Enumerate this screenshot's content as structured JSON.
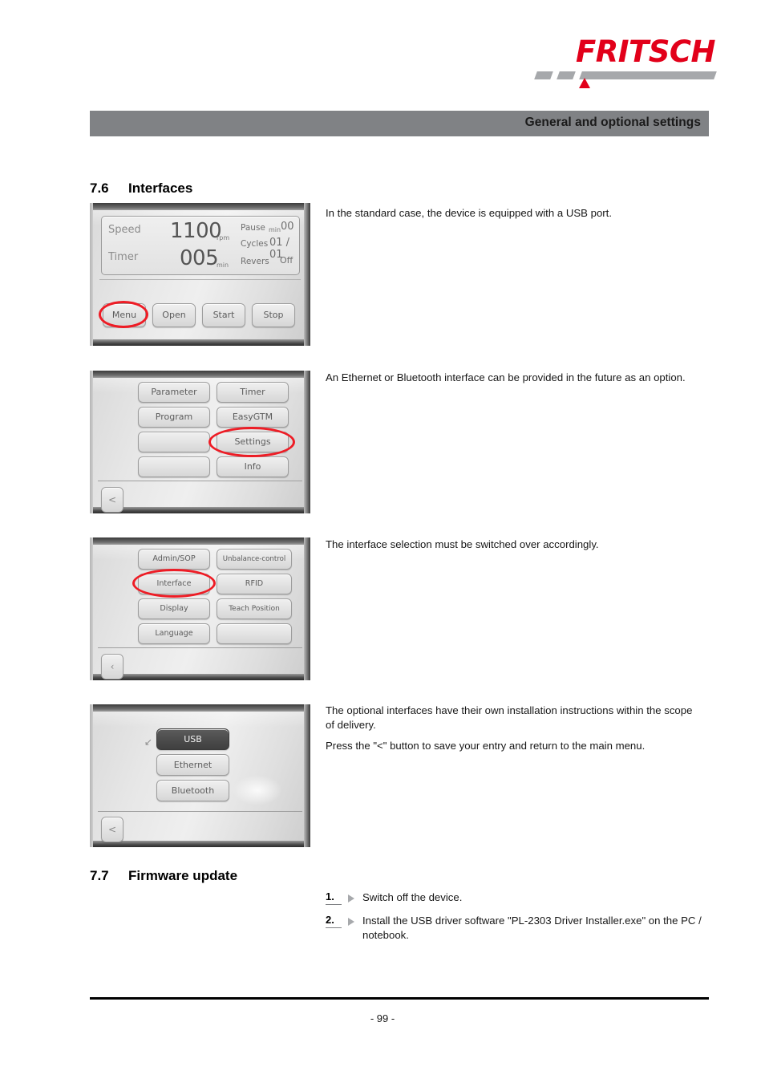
{
  "brand": {
    "logo_text": "FRITSCH",
    "logo_color": "#e2001a",
    "logo_bar_color": "#a6a8ab"
  },
  "header": {
    "running_title": "General and optional settings",
    "bar_color": "#808285"
  },
  "sections": [
    {
      "number": "7.6",
      "title": "Interfaces"
    },
    {
      "number": "7.7",
      "title": "Firmware update"
    }
  ],
  "paragraphs": {
    "p1": "In the standard case, the device is equipped with a USB port.",
    "p2": "An Ethernet or Bluetooth interface can be provided in the future as an option.",
    "p3": "The interface selection must be switched over accordingly.",
    "p4": "The optional interfaces have their own installation instructions within the scope of delivery.",
    "p5": "Press the \"<\" button to save your entry and return to the main menu."
  },
  "steps": [
    {
      "number": "1.",
      "text": "Switch off the device."
    },
    {
      "number": "2.",
      "text": "Install the USB driver software \"PL-2303 Driver Installer.exe\" on the PC / notebook."
    }
  ],
  "footer": {
    "page_number": "- 99 -"
  },
  "annotation": {
    "highlight_color": "#ee1c25"
  },
  "figures": [
    {
      "id": "figure-status-screen",
      "caption_ref": "7.6",
      "readout": {
        "speed_label": "Speed",
        "speed_value": "1100",
        "speed_unit": "rpm",
        "timer_label": "Timer",
        "timer_value": "005",
        "timer_unit": "min",
        "pause_label": "Pause",
        "pause_unit": "min",
        "pause_value": "00",
        "cycles_label": "Cycles",
        "cycles_value": "01 / 01",
        "revers_label": "Revers",
        "revers_value": "Off"
      },
      "buttons": [
        "Menu",
        "Open",
        "Start",
        "Stop"
      ],
      "highlighted_button": "Menu"
    },
    {
      "id": "figure-main-menu",
      "buttons_left": [
        "Parameter",
        "Program",
        "",
        ""
      ],
      "buttons_right": [
        "Timer",
        "EasyGTM",
        "Settings",
        "Info"
      ],
      "back_button": "<",
      "highlighted_button": "Settings"
    },
    {
      "id": "figure-settings-menu",
      "buttons_left": [
        "Admin/SOP",
        "Interface",
        "Display",
        "Language"
      ],
      "buttons_right": [
        "Unbalance-control",
        "RFID",
        "Teach Position",
        ""
      ],
      "back_button": "‹",
      "highlighted_button": "Interface"
    },
    {
      "id": "figure-interface-menu",
      "options": [
        "USB",
        "Ethernet",
        "Bluetooth"
      ],
      "selected_option": "USB",
      "back_button": "<"
    }
  ]
}
